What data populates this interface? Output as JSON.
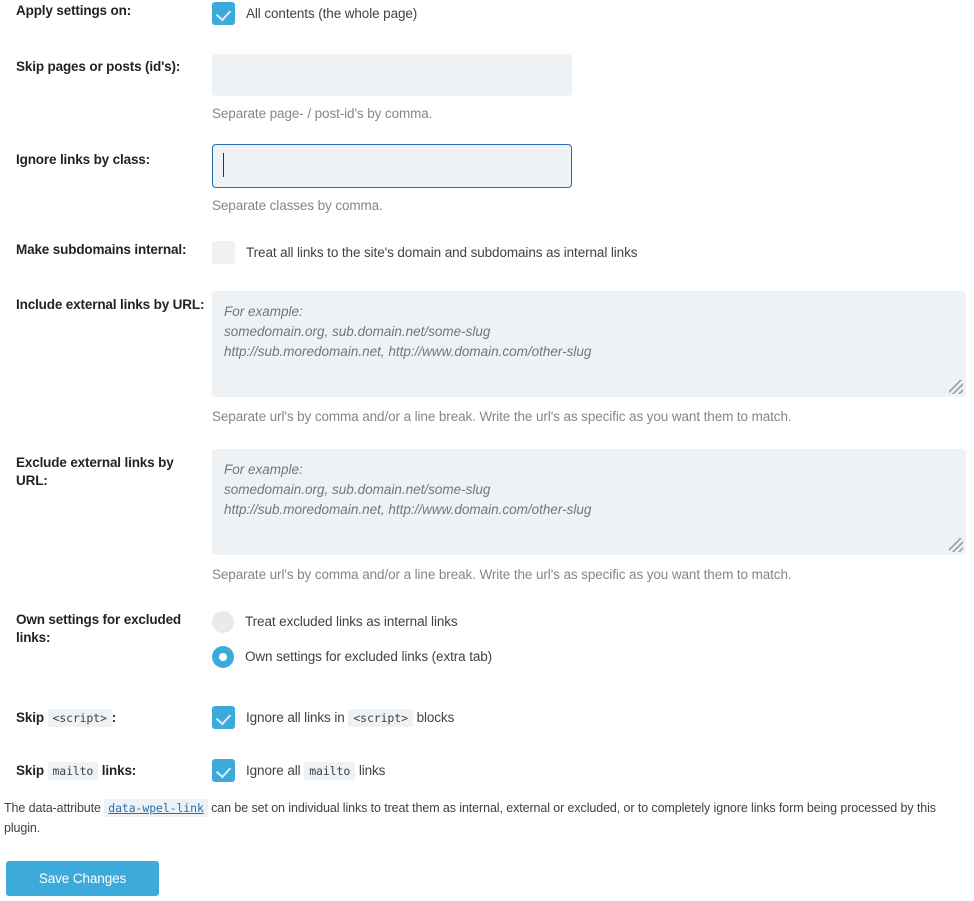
{
  "rows": {
    "apply_settings": {
      "label": "Apply settings on:",
      "checkbox_label": "All contents (the whole page)",
      "checked": true
    },
    "skip_pages": {
      "label": "Skip pages or posts (id's):",
      "value": "",
      "placeholder": "",
      "description": "Separate page- / post-id's by comma."
    },
    "ignore_class": {
      "label": "Ignore links by class:",
      "value": "",
      "placeholder": "",
      "description": "Separate classes by comma.",
      "focused": true
    },
    "subdomains_internal": {
      "label": "Make subdomains internal:",
      "checkbox_label": "Treat all links to the site's domain and subdomains as internal links",
      "checked": false
    },
    "include_external": {
      "label": "Include external links by URL:",
      "value": "",
      "placeholder": "For example:\nsomedomain.org, sub.domain.net/some-slug\nhttp://sub.moredomain.net, http://www.domain.com/other-slug",
      "description": "Separate url's by comma and/or a line break. Write the url's as specific as you want them to match."
    },
    "exclude_external": {
      "label": "Exclude external links by URL:",
      "value": "",
      "placeholder": "For example:\nsomedomain.org, sub.domain.net/some-slug\nhttp://sub.moredomain.net, http://www.domain.com/other-slug",
      "description": "Separate url's by comma and/or a line break. Write the url's as specific as you want them to match."
    },
    "excluded_settings": {
      "label": "Own settings for excluded links:",
      "options": [
        {
          "label": "Treat excluded links as internal links",
          "selected": false
        },
        {
          "label": "Own settings for excluded links (extra tab)",
          "selected": true
        }
      ]
    },
    "skip_script": {
      "label_before": "Skip",
      "label_code": "<script>",
      "label_after": ":",
      "checkbox_before": "Ignore all links in",
      "checkbox_code": "<script>",
      "checkbox_after": "blocks",
      "checked": true
    },
    "skip_mailto": {
      "label_before": "Skip",
      "label_code": "mailto",
      "label_after": "links:",
      "checkbox_before": "Ignore all",
      "checkbox_code": "mailto",
      "checkbox_after": "links",
      "checked": true
    }
  },
  "note": {
    "before": "The data-attribute",
    "link": "data-wpel-link",
    "after": "can be set on individual links to treat them as internal, external or excluded, or to completely ignore links form being processed by this plugin."
  },
  "save": {
    "label": "Save Changes"
  },
  "colors": {
    "accent": "#3cabdc",
    "field_bg": "#eef2f5",
    "focus_border": "#2b6cb0",
    "label_text": "#1d2327",
    "desc_text": "#7d8893",
    "link": "#2271b1"
  }
}
